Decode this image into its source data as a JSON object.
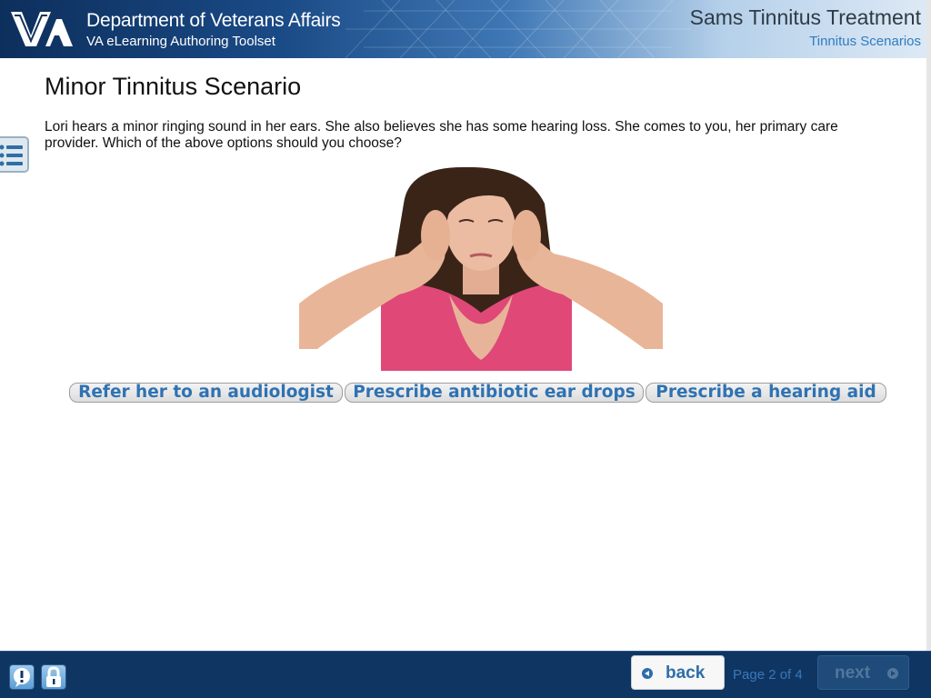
{
  "header": {
    "org_title": "Department of Veterans Affairs",
    "org_subtitle": "VA eLearning Authoring Toolset",
    "course_title": "Sams Tinnitus Treatment",
    "section_title": "Tinnitus Scenarios",
    "logo_text": "VA"
  },
  "main": {
    "title": "Minor Tinnitus Scenario",
    "prompt": "Lori hears a minor ringing sound in her ears.  She also believes she has some hearing loss.  She comes to you, her primary care provider.  Which of the above options should you choose?",
    "choices": [
      {
        "label": "Refer her to an audiologist"
      },
      {
        "label": "Prescribe antibiotic ear drops"
      },
      {
        "label": "Prescribe a hearing aid"
      }
    ]
  },
  "footer": {
    "back_label": "back",
    "page_indicator": "Page 2 of 4",
    "next_label": "next"
  },
  "colors": {
    "footer_bg": "#0f3563",
    "choice_text": "#2f72b2",
    "section_title": "#2f7cc0"
  }
}
